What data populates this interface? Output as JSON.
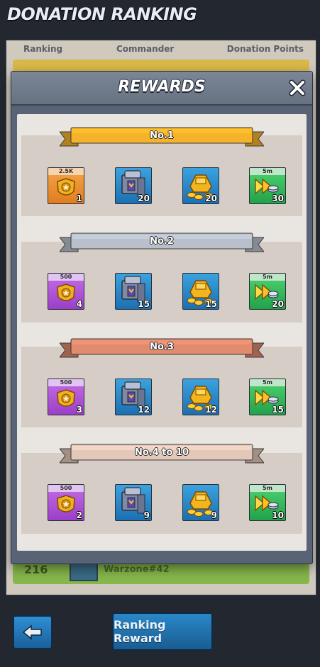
{
  "screen": {
    "title": "DONATION RANKING"
  },
  "table": {
    "columns": [
      "Ranking",
      "Commander",
      "Donation Points"
    ],
    "partial_row": {
      "rank": "216",
      "commander": "Warzone#42"
    }
  },
  "modal": {
    "title": "REWARDS",
    "tiers": [
      {
        "label": "No.1",
        "color": "#f5b32a",
        "items": [
          {
            "icon": "commander-badge-icon",
            "rarity": "orange",
            "tag": "2.5K",
            "qty": "1"
          },
          {
            "icon": "iron-crate-icon",
            "rarity": "blue",
            "tag": "",
            "qty": "20"
          },
          {
            "icon": "gold-coins-icon",
            "rarity": "blue",
            "tag": "",
            "qty": "20"
          },
          {
            "icon": "speedup-icon",
            "rarity": "green",
            "tag": "5m",
            "qty": "30"
          }
        ]
      },
      {
        "label": "No.2",
        "color": "#b9c0cc",
        "items": [
          {
            "icon": "commander-badge-icon",
            "rarity": "purple",
            "tag": "500",
            "qty": "4"
          },
          {
            "icon": "iron-crate-icon",
            "rarity": "blue",
            "tag": "",
            "qty": "15"
          },
          {
            "icon": "gold-coins-icon",
            "rarity": "blue",
            "tag": "",
            "qty": "15"
          },
          {
            "icon": "speedup-icon",
            "rarity": "green",
            "tag": "5m",
            "qty": "20"
          }
        ]
      },
      {
        "label": "No.3",
        "color": "#e08a6e",
        "items": [
          {
            "icon": "commander-badge-icon",
            "rarity": "purple",
            "tag": "500",
            "qty": "3"
          },
          {
            "icon": "iron-crate-icon",
            "rarity": "blue",
            "tag": "",
            "qty": "12"
          },
          {
            "icon": "gold-coins-icon",
            "rarity": "blue",
            "tag": "",
            "qty": "12"
          },
          {
            "icon": "speedup-icon",
            "rarity": "green",
            "tag": "5m",
            "qty": "15"
          }
        ]
      },
      {
        "label": "No.4 to 10",
        "color": "#e3c7b8",
        "items": [
          {
            "icon": "commander-badge-icon",
            "rarity": "purple",
            "tag": "500",
            "qty": "2"
          },
          {
            "icon": "iron-crate-icon",
            "rarity": "blue",
            "tag": "",
            "qty": "9"
          },
          {
            "icon": "gold-coins-icon",
            "rarity": "blue",
            "tag": "",
            "qty": "9"
          },
          {
            "icon": "speedup-icon",
            "rarity": "green",
            "tag": "5m",
            "qty": "10"
          }
        ]
      }
    ]
  },
  "footer": {
    "ranking_reward_label": "Ranking Reward"
  }
}
